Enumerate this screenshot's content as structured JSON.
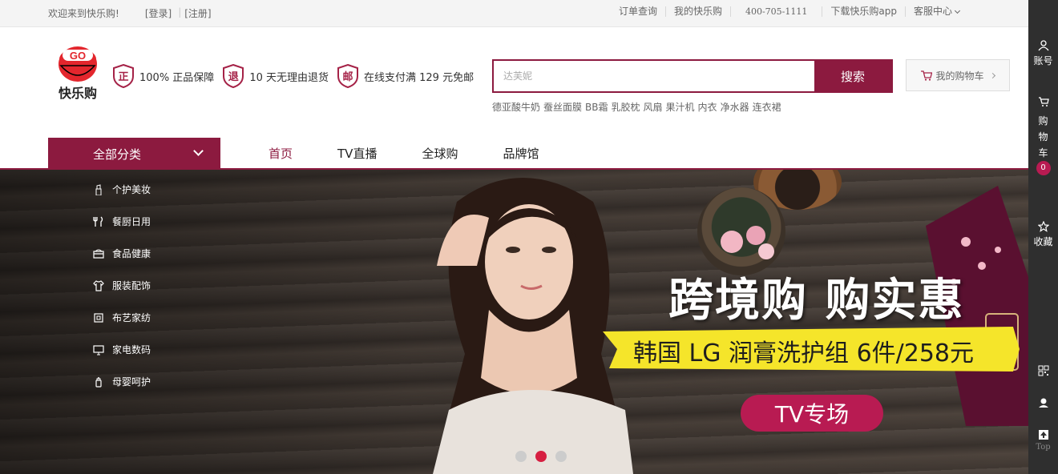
{
  "topbar": {
    "welcome": "欢迎来到快乐购!",
    "login": "[登录]",
    "register": "[注册]",
    "order_query": "订单查询",
    "my_account": "我的快乐购",
    "phone": "400-705-1111",
    "download_app": "下载快乐购app",
    "service_center": "客服中心"
  },
  "logo": {
    "text": "GO",
    "brand": "快乐购"
  },
  "promises": [
    {
      "badge": "正",
      "text": "100% 正品保障"
    },
    {
      "badge": "退",
      "text": "10 天无理由退货"
    },
    {
      "badge": "邮",
      "text": "在线支付满 129 元免邮"
    }
  ],
  "search": {
    "placeholder": "达芙妮",
    "button": "搜索",
    "hot_words": [
      "德亚酸牛奶",
      "蚕丝面膜",
      "BB霜",
      "乳胶枕",
      "风扇",
      "果汁机",
      "内衣",
      "净水器",
      "连衣裙"
    ]
  },
  "cart": {
    "label": "我的购物车"
  },
  "nav": {
    "all_categories": "全部分类",
    "links": [
      "首页",
      "TV直播",
      "全球购",
      "品牌馆"
    ]
  },
  "categories": [
    {
      "label": "个护美妆",
      "icon": "lipstick-icon"
    },
    {
      "label": "餐厨日用",
      "icon": "utensils-icon"
    },
    {
      "label": "食品健康",
      "icon": "food-icon"
    },
    {
      "label": "服装配饰",
      "icon": "shirt-icon"
    },
    {
      "label": "布艺家纺",
      "icon": "fabric-icon"
    },
    {
      "label": "家电数码",
      "icon": "monitor-icon"
    },
    {
      "label": "母婴呵护",
      "icon": "bottle-icon"
    }
  ],
  "banner": {
    "headline": "跨境购 购实惠",
    "ribbon": "韩国 LG 润膏洗护组 6件/258元",
    "pill": "TV专场",
    "slides_total": 3,
    "active_slide": 2
  },
  "sidebar": {
    "account": "账号",
    "cart_chars": [
      "购",
      "物",
      "车"
    ],
    "cart_count": "0",
    "favorites": "收藏",
    "top": "Top"
  },
  "colors": {
    "brand": "#8c1a3f",
    "accent": "#b81b52",
    "ribbon": "#f5e52a"
  }
}
